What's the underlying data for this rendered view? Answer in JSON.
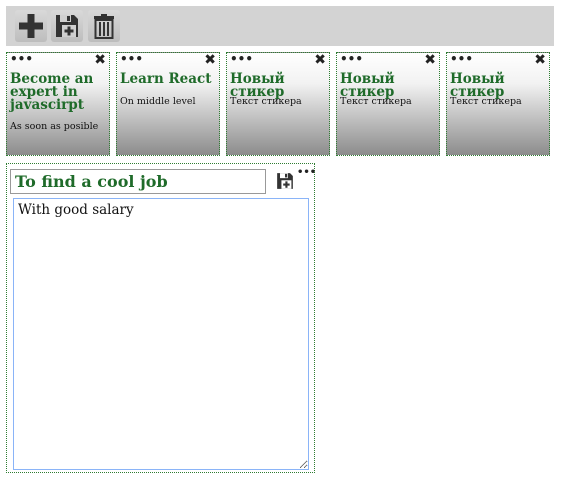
{
  "toolbar": {
    "add_icon": "plus-icon",
    "save_icon": "save-plus-icon",
    "delete_icon": "trash-icon"
  },
  "stickers": [
    {
      "menu": "•••",
      "close": "✖",
      "title": "Become an expert in javascirpt",
      "text": "As soon as posible"
    },
    {
      "menu": "•••",
      "close": "✖",
      "title": "Learn React",
      "text": "On middle level"
    },
    {
      "menu": "•••",
      "close": "✖",
      "title": "Новый стикер",
      "text": "Текст стикера"
    },
    {
      "menu": "•••",
      "close": "✖",
      "title": "Новый стикер",
      "text": "Текст стикера"
    },
    {
      "menu": "•••",
      "close": "✖",
      "title": "Новый стикер",
      "text": "Текст стикера"
    }
  ],
  "editor": {
    "title_value": "To find a cool job",
    "body_value": "With good salary",
    "more": "•••"
  },
  "colors": {
    "title_green": "#1f6b2a",
    "toolbar_bg": "#d3d3d3",
    "border_green": "#2e7d32",
    "textarea_focus": "#8ab4f8"
  }
}
